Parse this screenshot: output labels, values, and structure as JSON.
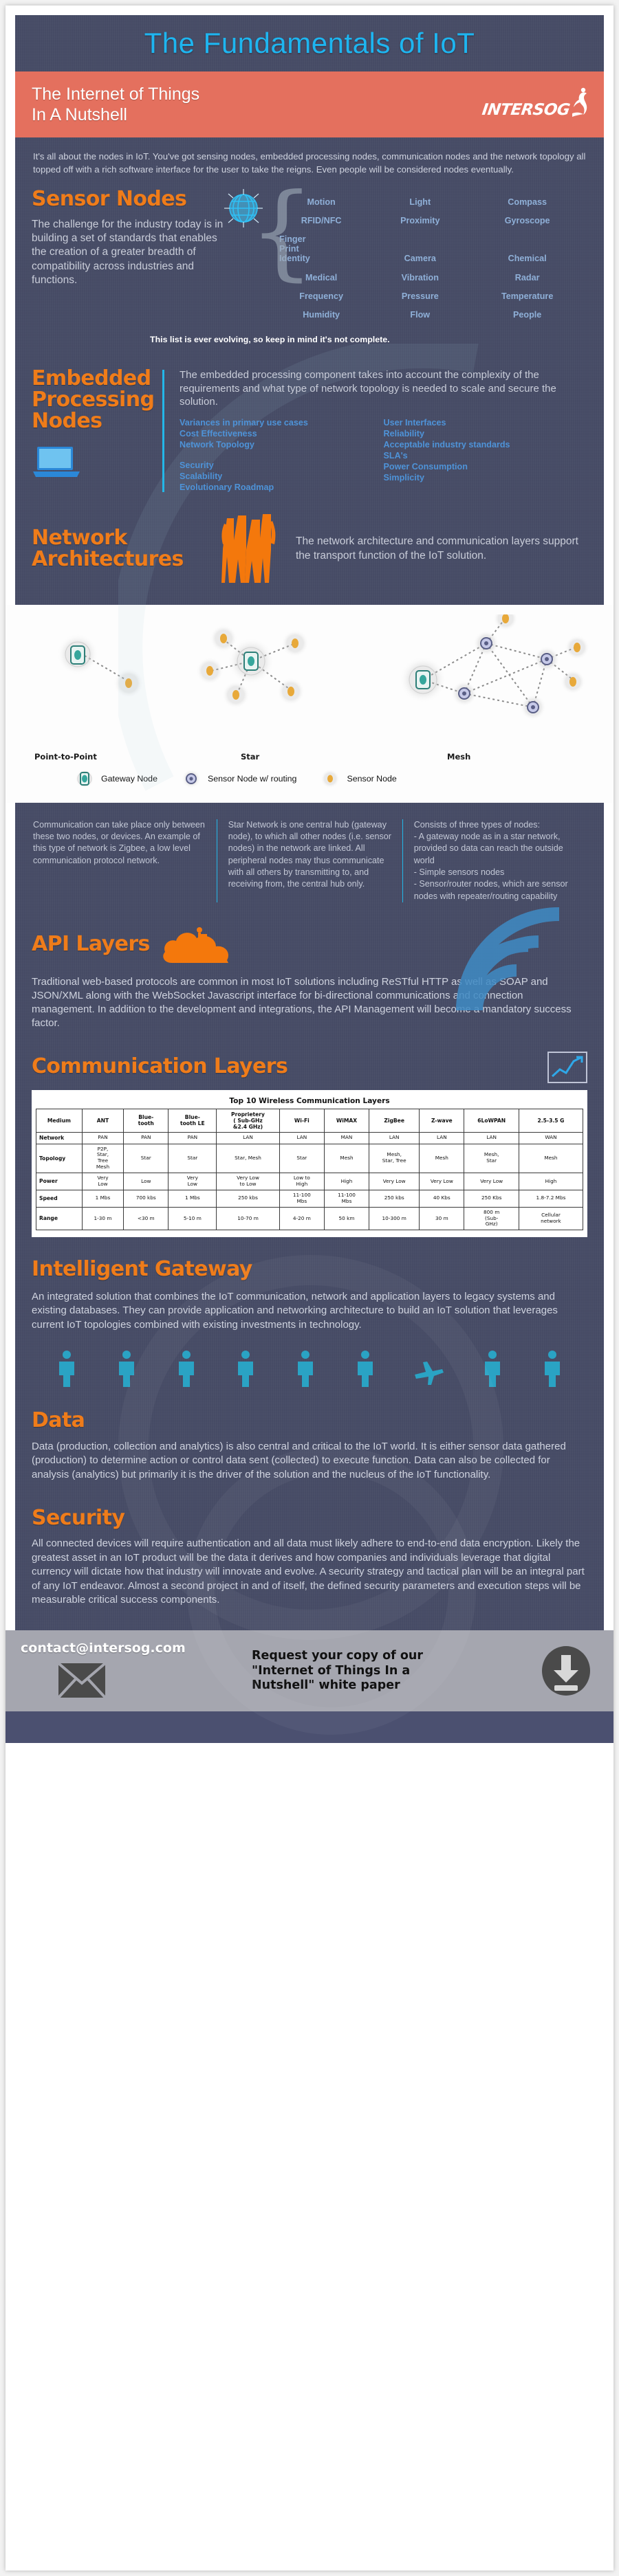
{
  "header": {
    "title": "The Fundamentals of IoT",
    "subtitle_line1": "The Internet of Things",
    "subtitle_line2": "In A Nutshell",
    "logo_text": "INTERSOG"
  },
  "intro": {
    "text": "It's all about the nodes in IoT. You've got sensing nodes, embedded processing nodes, communication nodes and the network topology all topped off with a rich software interface for the user to take the reigns. Even people will be considered nodes eventually."
  },
  "sensor_nodes": {
    "heading": "Sensor Nodes",
    "body": "The challenge for the industry today is in building a set of standards that enables the creation of a greater breadth of compatibility across industries and functions.",
    "sensor_rows": [
      [
        "Motion",
        "Light",
        "Compass"
      ],
      [
        "RFID/NFC",
        "Proximity",
        "Gyroscope"
      ],
      [
        "Finger\nPrint\nIdentity",
        "Camera",
        "Chemical"
      ],
      [
        "Medical",
        "Vibration",
        "Radar"
      ],
      [
        "Frequency",
        "Pressure",
        "Temperature"
      ],
      [
        "Humidity",
        "Flow",
        "People"
      ]
    ],
    "note": "This list is ever evolving, so keep in mind it's not complete."
  },
  "embedded_processing": {
    "heading": "Embedded Processing Nodes",
    "body": "The embedded processing component takes into account the complexity of the requirements and what type of network topology is needed to scale and secure the solution.",
    "left_col_group1": [
      "Variances in primary use cases",
      "Cost Effectiveness",
      "Network Topology"
    ],
    "left_col_group2": [
      "Security",
      "Scalability",
      "Evolutionary Roadmap"
    ],
    "right_col_group1": [
      "User Interfaces",
      "Reliability",
      "Acceptable industry standards"
    ],
    "right_col_group2": [
      "SLA's",
      "Power Consumption",
      "Simplicity"
    ]
  },
  "network_architectures": {
    "heading": "Network Architectures",
    "body": "The network architecture and communication layers support the transport function of the IoT solution."
  },
  "topologies": {
    "labels": [
      "Point-to-Point",
      "Star",
      "Mesh"
    ],
    "legend": [
      "Gateway Node",
      "Sensor Node w/ routing",
      "Sensor Node"
    ],
    "descriptions": [
      "Communication can take place only between these two nodes, or devices. An example of this type of network is Zigbee, a low level communication protocol network.",
      "Star Network is one central hub (gateway node), to which all other nodes (i.e. sensor nodes) in the network are linked. All peripheral nodes may thus communicate with all others by transmitting to, and receiving from, the central hub only.",
      "Consists of three types of nodes:\n- A gateway node as in a star network, provided so data can reach the outside world\n- Simple sensors nodes\n- Sensor/router nodes, which are sensor nodes with repeater/routing capability"
    ]
  },
  "api_layers": {
    "heading": "API Layers",
    "body": "Traditional web-based protocols are common in most IoT solutions including ReSTful HTTP as well as SOAP and JSON/XML along with the WebSocket Javascript interface for bi-directional communications and connection management. In addition to the development and integrations, the API Management will become a mandatory success factor."
  },
  "communication_layers": {
    "heading": "Communication Layers",
    "table_caption": "Top 10 Wireless Communication Layers",
    "columns": [
      "Medium",
      "ANT",
      "Blue-\ntooth",
      "Blue-\ntooth LE",
      "Proprietery\n( Sub-GHz\n&2.4 GHz)",
      "Wi-Fi",
      "WiMAX",
      "ZigBee",
      "Z-wave",
      "6LoWPAN",
      "2.5-3.5 G"
    ],
    "rows": [
      {
        "label": "Network",
        "values": [
          "PAN",
          "PAN",
          "PAN",
          "LAN",
          "LAN",
          "MAN",
          "LAN",
          "LAN",
          "LAN",
          "WAN"
        ]
      },
      {
        "label": "Topology",
        "values": [
          "P2P,\nStar,\nTree\nMesh",
          "Star",
          "Star",
          "Star, Mesh",
          "Star",
          "Mesh",
          "Mesh,\nStar, Tree",
          "Mesh",
          "Mesh,\nStar",
          "Mesh"
        ]
      },
      {
        "label": "Power",
        "values": [
          "Very\nLow",
          "Low",
          "Very\nLow",
          "Very Low\nto Low",
          "Low to\nHigh",
          "High",
          "Very Low",
          "Very Low",
          "Very Low",
          "High"
        ]
      },
      {
        "label": "Speed",
        "values": [
          "1 Mbs",
          "700 kbs",
          "1 Mbs",
          "250 kbs",
          "11-100\nMbs",
          "11-100\nMbs",
          "250 kbs",
          "40 Kbs",
          "250 Kbs",
          "1.8-7.2 Mbs"
        ]
      },
      {
        "label": "Range",
        "values": [
          "1-30 m",
          "<30 m",
          "5-10 m",
          "10-70 m",
          "4-20 m",
          "50 km",
          "10-300 m",
          "30 m",
          "800 m\n(Sub-\nGHz)",
          "Cellular\nnetwork"
        ]
      }
    ]
  },
  "intelligent_gateway": {
    "heading": "Intelligent Gateway",
    "body": "An integrated solution that combines the IoT communication, network and application layers to legacy systems and existing databases. They can provide application and networking architecture to build an IoT solution that leverages current IoT topologies combined with existing investments in technology."
  },
  "data_section": {
    "heading": "Data",
    "body": "Data (production, collection and analytics) is also central and critical to the IoT world. It is either sensor data gathered (production) to determine action or control data sent (collected) to execute function. Data can also be collected for analysis (analytics) but primarily it is the driver of the solution and the nucleus of the IoT functionality."
  },
  "security_section": {
    "heading": "Security",
    "body": "All connected devices will require authentication and all data must likely adhere to end-to-end data encryption. Likely the greatest asset in an IoT product will be the data it derives and how companies and individuals leverage that digital currency will dictate how that industry will innovate and evolve. A security strategy and tactical plan will be an integral part of any IoT endeavor. Almost a second project in and of itself, the defined security parameters and execution steps will be measurable critical success components."
  },
  "footer": {
    "email": "contact@intersog.com",
    "cta_line1": "Request your copy of our",
    "cta_line2": "\"Internet of Things In a",
    "cta_line3": "Nutshell\" white paper"
  },
  "colors": {
    "dark_bg": "#474c66",
    "orange": "#ef7c1a",
    "banner_orange": "#e4705e",
    "cyan": "#1eb5f0",
    "blue_list": "#4e93d8",
    "sensor_blue": "#8fb0d8"
  }
}
